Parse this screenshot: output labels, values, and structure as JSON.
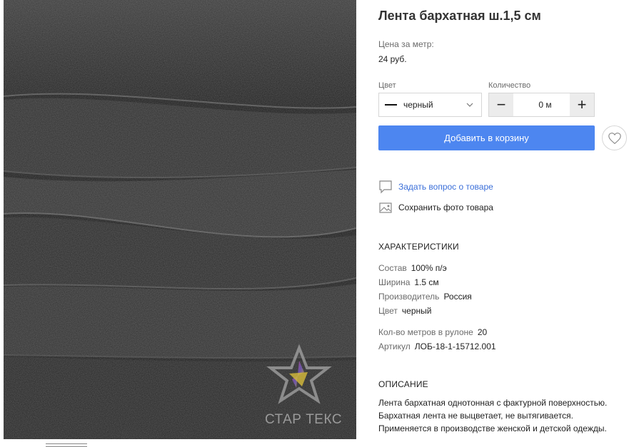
{
  "product": {
    "title": "Лента бархатная ш.1,5 см",
    "price_label": "Цена за метр:",
    "price_value": "24 руб."
  },
  "image": {
    "watermark": "СТАР ТЕКС",
    "alt_subject": "black-velvet-ribbon-photo"
  },
  "options": {
    "color_label": "Цвет",
    "color_value": "черный",
    "swatch_color": "#111111",
    "qty_label": "Количество",
    "qty_value": "0 м",
    "minus": "−",
    "plus": "+"
  },
  "actions": {
    "add_to_cart": "Добавить в корзину",
    "ask_question": "Задать вопрос о товаре",
    "save_photo": "Сохранить фото товара"
  },
  "characteristics": {
    "heading": "ХАРАКТЕРИСТИКИ",
    "items": [
      {
        "key": "Состав",
        "value": "100% п/э"
      },
      {
        "key": "Ширина",
        "value": "1.5 см"
      },
      {
        "key": "Производитель",
        "value": "Россия"
      },
      {
        "key": "Цвет",
        "value": "черный"
      },
      {
        "key": "Кол-во метров в рулоне",
        "value": "20"
      },
      {
        "key": "Артикул",
        "value": "ЛОБ-18-1-15712.001"
      }
    ]
  },
  "description": {
    "heading": "ОПИСАНИЕ",
    "text": "Лента бархатная однотонная с фактурной поверхностью. Бархатная лента не выцветает, не вытягивается. Применяется в производстве женской и детской одежды."
  },
  "colors": {
    "accent": "#4d86f0",
    "link": "#3b6fd9",
    "muted": "#6b6b6b"
  }
}
